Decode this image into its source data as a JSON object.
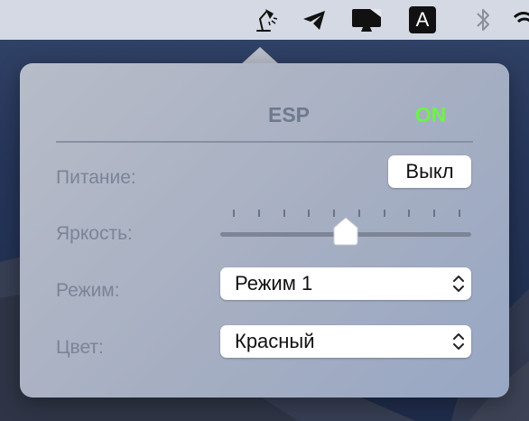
{
  "menubar": {
    "items": [
      {
        "icon": "desk-lamp-icon"
      },
      {
        "icon": "telegram-icon"
      },
      {
        "icon": "display-icon"
      },
      {
        "icon": "input-source-icon",
        "label": "A"
      },
      {
        "icon": "bluetooth-icon"
      },
      {
        "icon": "wifi-icon"
      }
    ]
  },
  "popover": {
    "device_name": "ESP",
    "device_state": "ON",
    "rows": {
      "power_label": "Питание:",
      "power_button": "Выкл",
      "brightness_label": "Яркость:",
      "brightness_level": 0.5,
      "brightness_ticks": 10,
      "mode_label": "Режим:",
      "mode_value": "Режим 1",
      "color_label": "Цвет:",
      "color_value": "Красный"
    }
  },
  "colors": {
    "state_on": "#6ff24a",
    "header_text": "#6e7a8d",
    "label_text": "#7b8496"
  }
}
